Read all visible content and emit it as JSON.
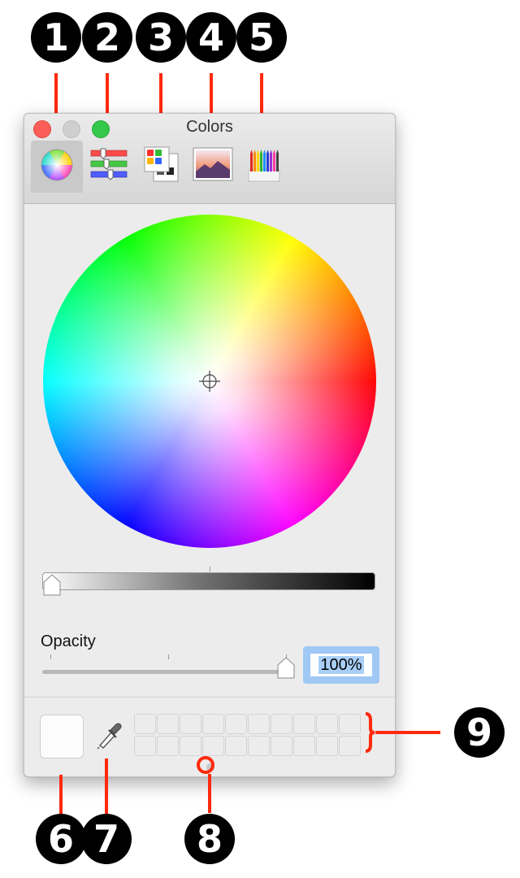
{
  "window": {
    "title": "Colors",
    "tabs": [
      {
        "label": "Color Wheel",
        "icon": "color-wheel-icon"
      },
      {
        "label": "Color Sliders",
        "icon": "color-sliders-icon"
      },
      {
        "label": "Color Palettes",
        "icon": "color-palettes-icon"
      },
      {
        "label": "Image Palettes",
        "icon": "image-palettes-icon"
      },
      {
        "label": "Pencils",
        "icon": "pencils-icon"
      }
    ],
    "selected_tab": "Color Wheel",
    "opacity": {
      "label": "Opacity",
      "value": "100%"
    },
    "current_color": "#fcfcfc",
    "swatch_slots": {
      "rows": 2,
      "columns": 10
    }
  },
  "callouts": [
    "1",
    "2",
    "3",
    "4",
    "5",
    "6",
    "7",
    "8",
    "9"
  ],
  "colors": {
    "callout": "#000000",
    "annotation_line": "#ff2a0e",
    "focus_ring": "#9fc8f4"
  }
}
